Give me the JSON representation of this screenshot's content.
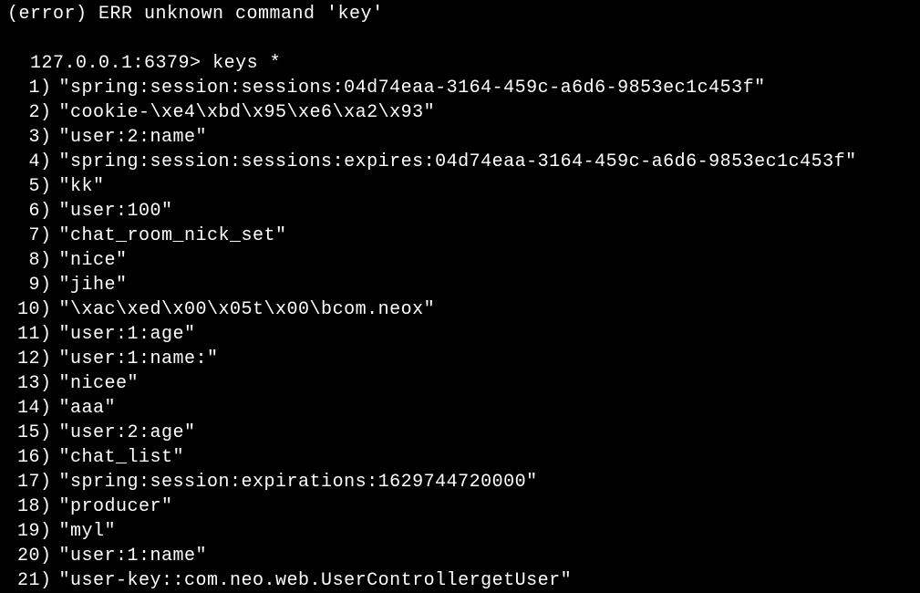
{
  "error_line": "(error) ERR unknown command 'key'",
  "prompt": "127.0.0.1:6379>",
  "command": "keys *",
  "results": [
    {
      "n": "1",
      "v": "\"spring:session:sessions:04d74eaa-3164-459c-a6d6-9853ec1c453f\""
    },
    {
      "n": "2",
      "v": "\"cookie-\\xe4\\xbd\\x95\\xe6\\xa2\\x93\""
    },
    {
      "n": "3",
      "v": "\"user:2:name\""
    },
    {
      "n": "4",
      "v": "\"spring:session:sessions:expires:04d74eaa-3164-459c-a6d6-9853ec1c453f\""
    },
    {
      "n": "5",
      "v": "\"kk\""
    },
    {
      "n": "6",
      "v": "\"user:100\""
    },
    {
      "n": "7",
      "v": "\"chat_room_nick_set\""
    },
    {
      "n": "8",
      "v": "\"nice\""
    },
    {
      "n": "9",
      "v": "\"jihe\""
    },
    {
      "n": "10",
      "v": "\"\\xac\\xed\\x00\\x05t\\x00\\bcom.neox\""
    },
    {
      "n": "11",
      "v": "\"user:1:age\""
    },
    {
      "n": "12",
      "v": "\"user:1:name:\""
    },
    {
      "n": "13",
      "v": "\"nicee\""
    },
    {
      "n": "14",
      "v": "\"aaa\""
    },
    {
      "n": "15",
      "v": "\"user:2:age\""
    },
    {
      "n": "16",
      "v": "\"chat_list\""
    },
    {
      "n": "17",
      "v": "\"spring:session:expirations:1629744720000\""
    },
    {
      "n": "18",
      "v": "\"producer\""
    },
    {
      "n": "19",
      "v": "\"myl\""
    },
    {
      "n": "20",
      "v": "\"user:1:name\""
    },
    {
      "n": "21",
      "v": "\"user-key::com.neo.web.UserControllergetUser\""
    }
  ]
}
